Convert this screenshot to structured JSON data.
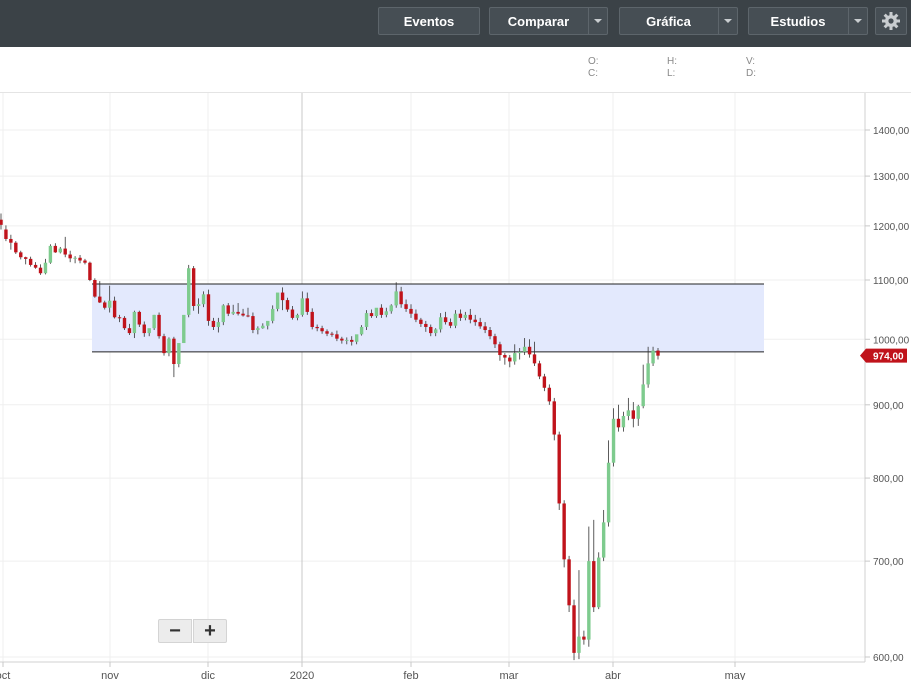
{
  "toolbar": {
    "buttons": [
      {
        "key": "events",
        "label": "Eventos"
      },
      {
        "key": "compare",
        "label": "Comparar"
      },
      {
        "key": "chart",
        "label": "Gráfica"
      },
      {
        "key": "studies",
        "label": "Estudios"
      }
    ]
  },
  "ohlc_labels": {
    "o": "O:",
    "h": "H:",
    "v": "V:",
    "c": "C:",
    "l": "L:",
    "d": "D:"
  },
  "zoom": {
    "out": "−",
    "in": "+"
  },
  "colors": {
    "up": "#7ecb8e",
    "down": "#c0131b",
    "band_fill": "#e3e9fd",
    "price_tag": "#c0131b",
    "toolbar": "#3b4247"
  },
  "chart_data": {
    "type": "candlestick",
    "y_scale": "log",
    "ylim": [
      600,
      1460
    ],
    "x_tick_labels": [
      "oct",
      "nov",
      "dic",
      "2020",
      "feb",
      "mar",
      "abr",
      "may"
    ],
    "y_tick_labels": [
      "1400,00",
      "1300,00",
      "1200,00",
      "1100,00",
      "1000,00",
      "900,00",
      "800,00",
      "700,00",
      "600,00"
    ],
    "y_tick_values": [
      1400,
      1300,
      1200,
      1100,
      1000,
      900,
      800,
      700,
      600
    ],
    "last_price": 974,
    "last_price_label": "974,00",
    "band": {
      "low": 980,
      "high": 1093
    },
    "candles": [
      [
        1212,
        1224,
        1202,
        1193
      ],
      [
        1193,
        1201,
        1175,
        1171
      ],
      [
        1175,
        1183,
        1168,
        1155
      ],
      [
        1168,
        1171,
        1150,
        1147
      ],
      [
        1150,
        1153,
        1141,
        1137
      ],
      [
        1141,
        1142,
        1138,
        1128
      ],
      [
        1138,
        1142,
        1127,
        1124
      ],
      [
        1127,
        1132,
        1122,
        1120
      ],
      [
        1122,
        1128,
        1112,
        1109
      ],
      [
        1112,
        1138,
        1131,
        1110
      ],
      [
        1131,
        1165,
        1162,
        1129
      ],
      [
        1162,
        1167,
        1150,
        1149
      ],
      [
        1150,
        1160,
        1157,
        1148
      ],
      [
        1157,
        1179,
        1146,
        1141
      ],
      [
        1146,
        1153,
        1139,
        1132
      ],
      [
        1139,
        1143,
        1140,
        1130
      ],
      [
        1140,
        1145,
        1135,
        1130
      ],
      [
        1135,
        1138,
        1131,
        1128
      ],
      [
        1131,
        1133,
        1100,
        1098
      ],
      [
        1100,
        1103,
        1071,
        1069
      ],
      [
        1071,
        1098,
        1061,
        1060
      ],
      [
        1061,
        1064,
        1052,
        1049
      ],
      [
        1052,
        1090,
        1064,
        1044
      ],
      [
        1064,
        1071,
        1036,
        1034
      ],
      [
        1036,
        1040,
        1035,
        1028
      ],
      [
        1035,
        1038,
        1018,
        1015
      ],
      [
        1018,
        1025,
        1010,
        1007
      ],
      [
        1010,
        1047,
        1045,
        1002
      ],
      [
        1045,
        1047,
        1024,
        1020
      ],
      [
        1024,
        1029,
        1010,
        1004
      ],
      [
        1010,
        1014,
        1018,
        1005
      ],
      [
        1018,
        1040,
        1040,
        1015
      ],
      [
        1040,
        1044,
        1005,
        1001
      ],
      [
        1005,
        1009,
        978,
        974
      ],
      [
        978,
        1003,
        1001,
        973
      ],
      [
        1001,
        1004,
        961,
        941
      ],
      [
        961,
        975,
        994,
        956
      ],
      [
        994,
        999,
        1040,
        1009
      ],
      [
        1040,
        1127,
        1121,
        1036
      ],
      [
        1121,
        1125,
        1055,
        1047
      ],
      [
        1055,
        1068,
        1058,
        1042
      ],
      [
        1058,
        1080,
        1075,
        1053
      ],
      [
        1075,
        1083,
        1030,
        1022
      ],
      [
        1030,
        1035,
        1020,
        1015
      ],
      [
        1020,
        1035,
        1028,
        1011
      ],
      [
        1028,
        1058,
        1056,
        1023
      ],
      [
        1056,
        1060,
        1042,
        1038
      ],
      [
        1042,
        1057,
        1045,
        1040
      ],
      [
        1045,
        1060,
        1042,
        1039
      ],
      [
        1042,
        1050,
        1039,
        1037
      ],
      [
        1039,
        1052,
        1038,
        1036
      ],
      [
        1038,
        1044,
        1015,
        1010
      ],
      [
        1015,
        1021,
        1018,
        1008
      ],
      [
        1018,
        1026,
        1022,
        1017
      ],
      [
        1022,
        1028,
        1030,
        1016
      ],
      [
        1030,
        1056,
        1050,
        1026
      ],
      [
        1050,
        1064,
        1078,
        1046
      ],
      [
        1078,
        1087,
        1065,
        1048
      ],
      [
        1065,
        1069,
        1049,
        1045
      ],
      [
        1049,
        1055,
        1035,
        1032
      ],
      [
        1035,
        1042,
        1040,
        1031
      ],
      [
        1040,
        1080,
        1068,
        1037
      ],
      [
        1068,
        1078,
        1045,
        1040
      ],
      [
        1045,
        1051,
        1020,
        1016
      ],
      [
        1020,
        1024,
        1018,
        1013
      ],
      [
        1018,
        1022,
        1013,
        1009
      ],
      [
        1013,
        1016,
        1009,
        1005
      ],
      [
        1009,
        1012,
        1008,
        1004
      ],
      [
        1008,
        1014,
        1001,
        997
      ],
      [
        1001,
        1004,
        998,
        993
      ],
      [
        998,
        1003,
        999,
        992
      ],
      [
        999,
        1005,
        996,
        990
      ],
      [
        996,
        1000,
        1008,
        992
      ],
      [
        1008,
        1023,
        1020,
        1006
      ],
      [
        1020,
        1048,
        1043,
        1015
      ],
      [
        1043,
        1049,
        1038,
        1035
      ],
      [
        1038,
        1046,
        1052,
        1035
      ],
      [
        1052,
        1058,
        1040,
        1035
      ],
      [
        1040,
        1052,
        1046,
        1036
      ],
      [
        1046,
        1058,
        1056,
        1042
      ],
      [
        1056,
        1096,
        1080,
        1052
      ],
      [
        1080,
        1088,
        1058,
        1052
      ],
      [
        1058,
        1066,
        1050,
        1045
      ],
      [
        1050,
        1058,
        1042,
        1035
      ],
      [
        1042,
        1049,
        1032,
        1028
      ],
      [
        1032,
        1035,
        1025,
        1020
      ],
      [
        1025,
        1030,
        1020,
        1012
      ],
      [
        1020,
        1024,
        1010,
        1005
      ],
      [
        1010,
        1018,
        1016,
        1005
      ],
      [
        1016,
        1043,
        1036,
        1011
      ],
      [
        1036,
        1045,
        1028,
        1024
      ],
      [
        1028,
        1034,
        1022,
        1018
      ],
      [
        1022,
        1048,
        1042,
        1018
      ],
      [
        1042,
        1049,
        1035,
        1030
      ],
      [
        1035,
        1045,
        1040,
        1031
      ],
      [
        1040,
        1050,
        1032,
        1026
      ],
      [
        1032,
        1040,
        1028,
        1022
      ],
      [
        1028,
        1035,
        1021,
        1017
      ],
      [
        1021,
        1028,
        1015,
        1010
      ],
      [
        1015,
        1020,
        1005,
        1000
      ],
      [
        1005,
        1009,
        992,
        986
      ],
      [
        992,
        996,
        975,
        966
      ],
      [
        975,
        978,
        971,
        960
      ],
      [
        971,
        975,
        965,
        956
      ],
      [
        965,
        992,
        978,
        960
      ],
      [
        978,
        986,
        980,
        968
      ],
      [
        980,
        1002,
        988,
        975
      ],
      [
        988,
        1000,
        976,
        971
      ],
      [
        976,
        996,
        962,
        958
      ],
      [
        962,
        966,
        942,
        938
      ],
      [
        942,
        946,
        925,
        920
      ],
      [
        925,
        930,
        905,
        900
      ],
      [
        905,
        910,
        858,
        850
      ],
      [
        858,
        862,
        768,
        760
      ],
      [
        768,
        772,
        702,
        693
      ],
      [
        702,
        706,
        652,
        645
      ],
      [
        652,
        658,
        604,
        597
      ],
      [
        604,
        690,
        620,
        598
      ],
      [
        620,
        626,
        617,
        612
      ],
      [
        617,
        740,
        700,
        610
      ],
      [
        700,
        748,
        650,
        645
      ],
      [
        650,
        710,
        704,
        648
      ],
      [
        704,
        760,
        745,
        700
      ],
      [
        745,
        850,
        820,
        740
      ],
      [
        820,
        895,
        880,
        815
      ],
      [
        880,
        900,
        868,
        862
      ],
      [
        868,
        890,
        884,
        862
      ],
      [
        884,
        910,
        892,
        878
      ],
      [
        892,
        904,
        880,
        868
      ],
      [
        880,
        900,
        898,
        870
      ],
      [
        898,
        960,
        930,
        895
      ],
      [
        930,
        988,
        962,
        925
      ],
      [
        962,
        988,
        982,
        958
      ],
      [
        982,
        986,
        974,
        968
      ]
    ]
  }
}
